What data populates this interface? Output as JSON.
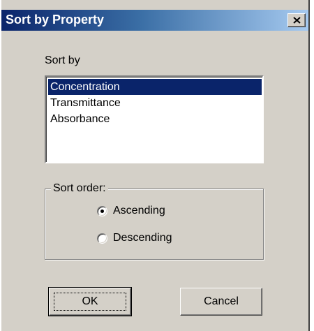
{
  "window": {
    "title": "Sort by Property"
  },
  "sort_by": {
    "label": "Sort by",
    "items": [
      {
        "label": "Concentration",
        "selected": true
      },
      {
        "label": "Transmittance",
        "selected": false
      },
      {
        "label": "Absorbance",
        "selected": false
      }
    ]
  },
  "sort_order": {
    "label": "Sort order:",
    "options": [
      {
        "label": "Ascending",
        "checked": true
      },
      {
        "label": "Descending",
        "checked": false
      }
    ]
  },
  "buttons": {
    "ok_label": "OK",
    "cancel_label": "Cancel"
  },
  "icons": {
    "close": "close-icon"
  },
  "colors": {
    "title_bar_start": "#0a246a",
    "title_bar_end": "#a6caf0",
    "selection": "#0a246a",
    "dialog_face": "#d4d0c8"
  }
}
